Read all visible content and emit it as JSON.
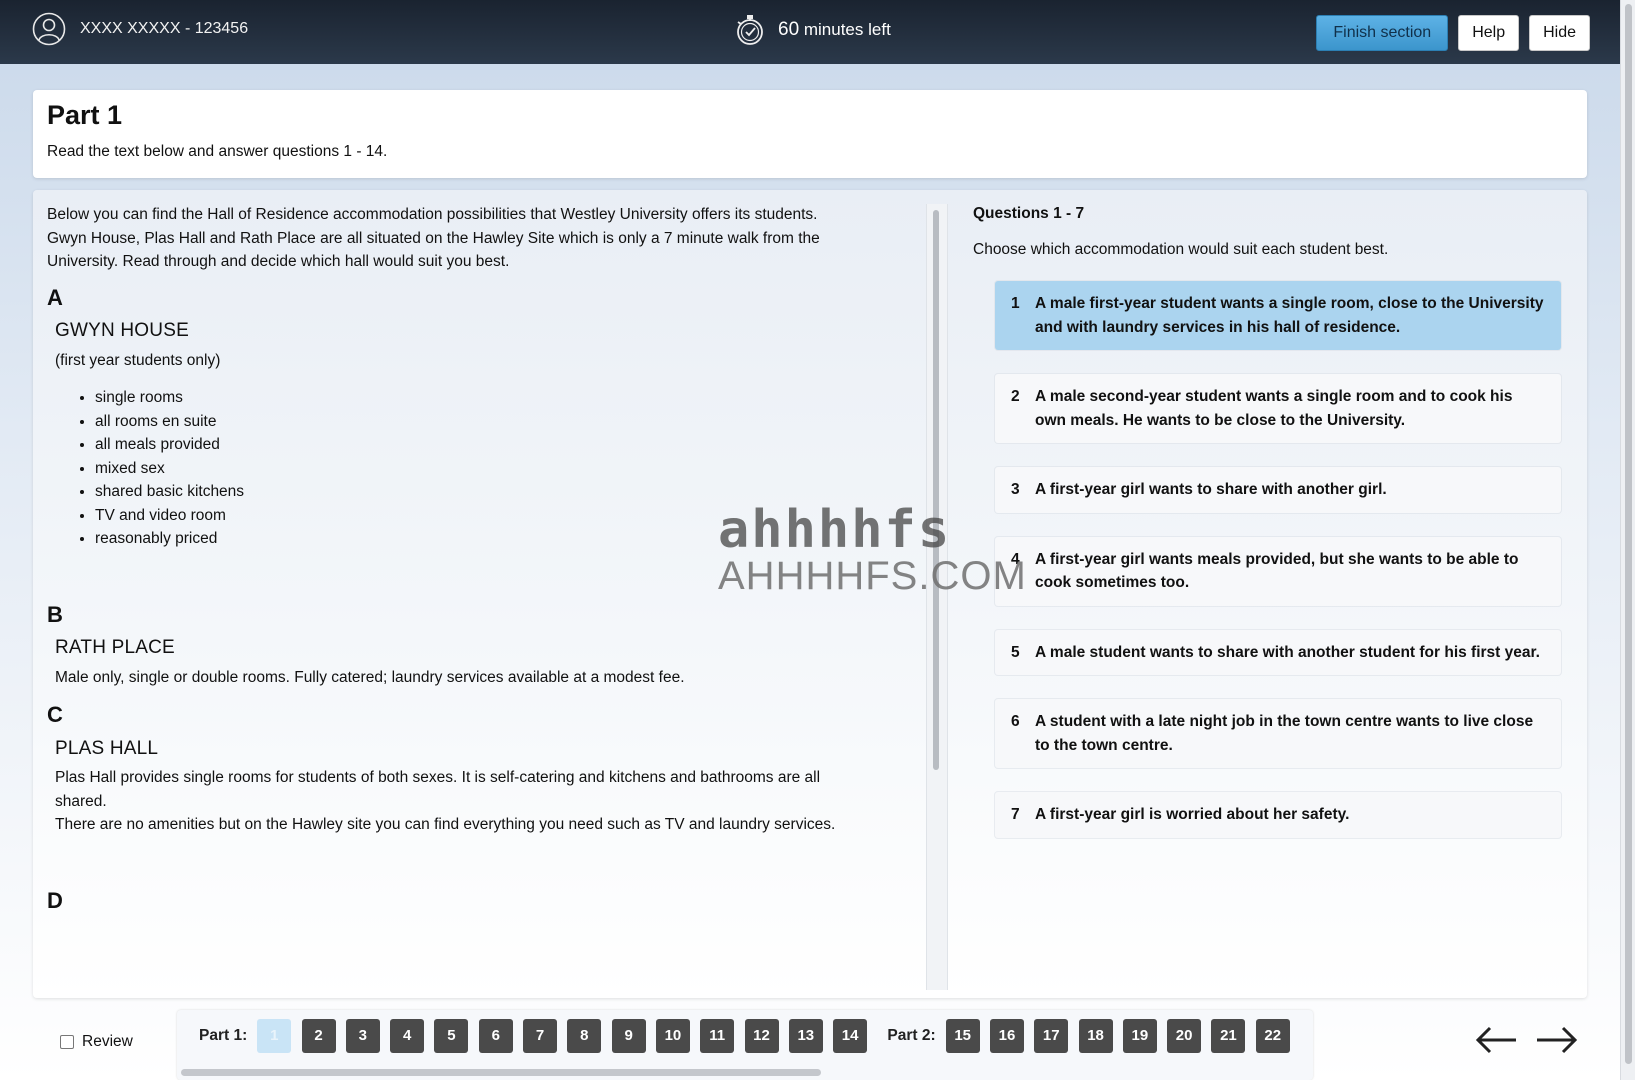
{
  "topbar": {
    "user_label": "XXXX XXXXX - 123456",
    "timer_value": "60",
    "timer_suffix": " minutes left",
    "finish_label": "Finish section",
    "help_label": "Help",
    "hide_label": "Hide"
  },
  "header": {
    "title": "Part 1",
    "instruction": "Read the text below and answer questions 1 - 14."
  },
  "passage": {
    "intro": "Below you can find the Hall of Residence accommodation possibilities that Westley University offers its students. Gwyn House, Plas Hall and Rath Place are all situated on the Hawley Site which is only a 7 minute walk from the University. Read through and decide which hall would suit you best.",
    "sections": [
      {
        "letter": "A",
        "name": "GWYN HOUSE",
        "sub": "(first year students only)",
        "bullets": [
          "single rooms",
          "all rooms en suite",
          "all meals provided",
          "mixed sex",
          "shared basic kitchens",
          "TV and video room",
          "reasonably priced"
        ]
      },
      {
        "letter": "B",
        "name": "RATH PLACE",
        "para1": "Male only, single or double rooms. Fully catered; laundry services available at a modest fee."
      },
      {
        "letter": "C",
        "name": "PLAS HALL",
        "para1": "Plas Hall provides single rooms for students of both sexes. It is self-catering and kitchens and bathrooms are all shared.",
        "para2": "There are no amenities but on the Hawley site you can find everything you need such as TV and laundry services."
      },
      {
        "letter": "D"
      }
    ]
  },
  "questions": {
    "title": "Questions 1 - 7",
    "instruction": "Choose which accommodation would suit each student best.",
    "items": [
      {
        "num": "1",
        "text": "A male first-year student wants a single room, close to the University and with laundry services in his hall of residence."
      },
      {
        "num": "2",
        "text": "A male second-year student wants a single room and to cook his own meals. He wants to be close to the University."
      },
      {
        "num": "3",
        "text": "A first-year girl wants to share with another girl."
      },
      {
        "num": "4",
        "text": "A first-year girl wants meals provided, but she wants to be able to cook sometimes too."
      },
      {
        "num": "5",
        "text": "A male student wants to share with another student for his first year."
      },
      {
        "num": "6",
        "text": "A student with a late night job in the town centre wants to live close to the town centre."
      },
      {
        "num": "7",
        "text": "A first-year girl is worried about her safety."
      }
    ]
  },
  "watermark": {
    "top": "ahhhhfs",
    "bottom": "AHHHHFS.COM"
  },
  "bottom_nav": {
    "review_label": "Review",
    "part1_label": "Part 1:",
    "part1_buttons": [
      "1",
      "2",
      "3",
      "4",
      "5",
      "6",
      "7",
      "8",
      "9",
      "10",
      "11",
      "12",
      "13",
      "14"
    ],
    "part2_label": "Part 2:",
    "part2_buttons": [
      "15",
      "16",
      "17",
      "18",
      "19",
      "20",
      "21",
      "22"
    ]
  },
  "colors": {
    "topbar": "#1f2a38",
    "finish_button": "#4aa3d8",
    "active_question": "#abd4ef",
    "question_button": "#4a4a4a"
  }
}
